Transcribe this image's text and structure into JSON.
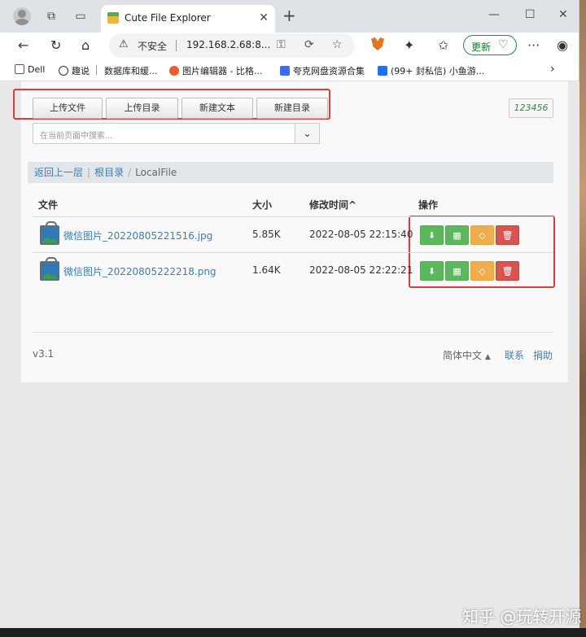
{
  "browser": {
    "tab_title": "Cute File Explorer",
    "omnibox": {
      "security": "不安全",
      "url": "192.168.2.68:8..."
    },
    "update_label": "更新",
    "bookmarks": [
      {
        "label": "Dell",
        "color": "#555555"
      },
      {
        "label": "趣说",
        "color": "#333333"
      },
      {
        "label": "数据库和缓...",
        "color": ""
      },
      {
        "label": "图片编辑器 - 比格...",
        "color": "#f05a28"
      },
      {
        "label": "夸克网盘资源合集",
        "color": "#3b6cf6"
      },
      {
        "label": "(99+ 封私信) 小鱼游...",
        "color": "#1772f6"
      }
    ]
  },
  "page": {
    "buttons": [
      "上传文件",
      "上传目录",
      "新建文本",
      "新建目录"
    ],
    "badge": "123456",
    "search_placeholder": "在当前页面中搜索...",
    "breadcrumb": {
      "back": "返回上一层",
      "root": "根目录",
      "current": "LocalFile"
    },
    "table_headers": {
      "file": "文件",
      "size": "大小",
      "modified": "修改时间",
      "actions": "操作"
    },
    "sort_indicator": "^",
    "files": [
      {
        "name": "微信图片_20220805221516.jpg",
        "size": "5.85K",
        "modified": "2022-08-05 22:15:40"
      },
      {
        "name": "微信图片_20220805222218.png",
        "size": "1.64K",
        "modified": "2022-08-05 22:22:21"
      }
    ],
    "footer": {
      "version": "v3.1",
      "language": "简体中文",
      "contact": "联系",
      "donate": "捐助"
    }
  },
  "watermark": "知乎 @玩转开源",
  "colors": {
    "link": "#3a7fb5",
    "success": "#5cb85c",
    "warning": "#f0ad4e",
    "danger": "#d9534f",
    "highlight": "#e53935"
  }
}
